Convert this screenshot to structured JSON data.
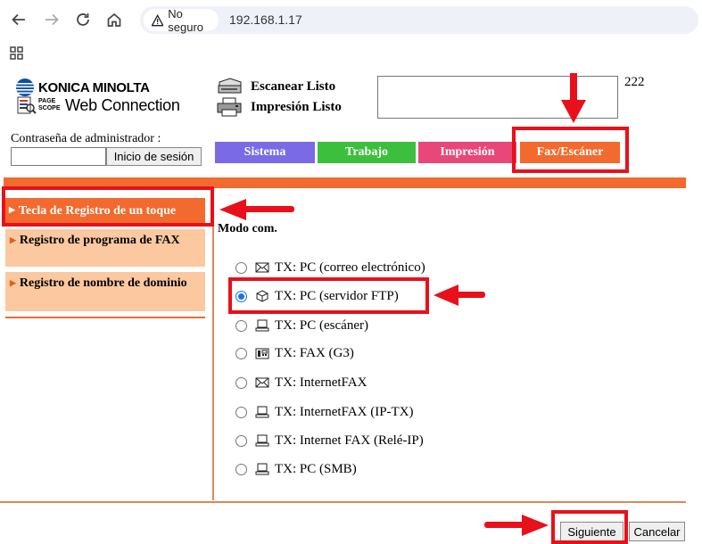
{
  "browser": {
    "security_label": "No seguro",
    "url": "192.168.1.17"
  },
  "header": {
    "brand": "KONICA MINOLTA",
    "product_small": "PAGE SCOPE",
    "product": "Web Connection",
    "scan_status": "Escanear Listo",
    "print_status": "Impresión Listo",
    "count": "222"
  },
  "admin": {
    "label": "Contraseña de administrador :",
    "password_value": "",
    "login_button": "Inicio de sesión"
  },
  "tabs": [
    {
      "label": "Sistema",
      "color": "#7b6ae6"
    },
    {
      "label": "Trabajo",
      "color": "#3cbf3c"
    },
    {
      "label": "Impresión",
      "color": "#e8477a"
    },
    {
      "label": "Fax/Escáner",
      "color": "#f26a2e"
    }
  ],
  "menu": {
    "active": "Tecla de Registro de un toque",
    "items": [
      "Registro de programa de FAX",
      "Registro de nombre de dominio"
    ]
  },
  "form": {
    "mode_label": "Modo com.",
    "selected_index": 1,
    "options": [
      {
        "label": "TX: PC (correo electrónico)",
        "icon": "envelope-icon"
      },
      {
        "label": "TX: PC (servidor FTP)",
        "icon": "cube-icon"
      },
      {
        "label": "TX: PC (escáner)",
        "icon": "computer-icon"
      },
      {
        "label": "TX: FAX (G3)",
        "icon": "fax-icon"
      },
      {
        "label": "TX: InternetFAX",
        "icon": "envelope-icon"
      },
      {
        "label": "TX: InternetFAX (IP-TX)",
        "icon": "computer-icon"
      },
      {
        "label": "TX: Internet FAX (Relé-IP)",
        "icon": "computer-icon"
      },
      {
        "label": "TX: PC (SMB)",
        "icon": "computer-icon"
      }
    ]
  },
  "buttons": {
    "next": "Siguiente",
    "cancel": "Cancelar"
  },
  "annotation_color": "#e8101a"
}
